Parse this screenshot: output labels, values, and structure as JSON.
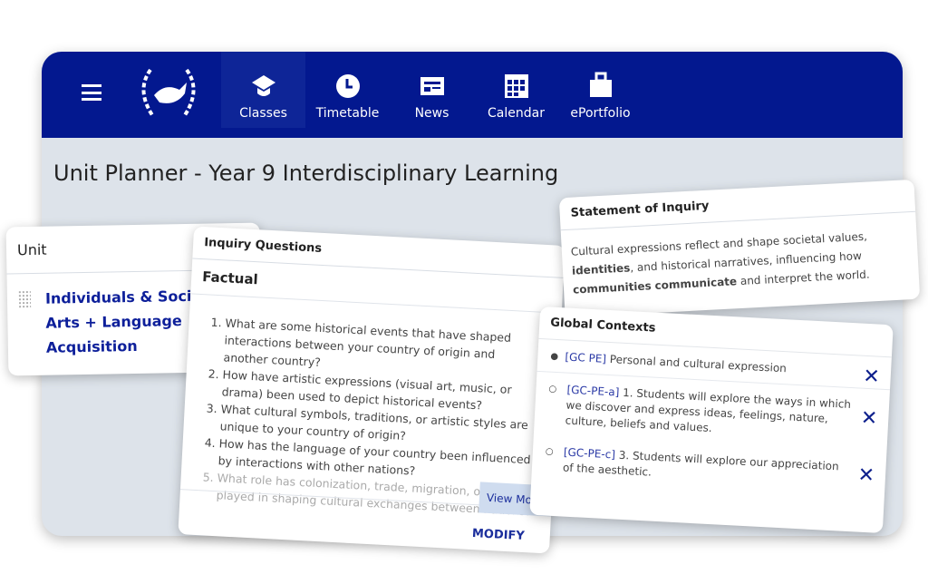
{
  "nav": {
    "items": [
      {
        "label": "Classes",
        "icon": "graduation-cap-icon",
        "active": true
      },
      {
        "label": "Timetable",
        "icon": "clock-icon"
      },
      {
        "label": "News",
        "icon": "newspaper-icon"
      },
      {
        "label": "Calendar",
        "icon": "calendar-icon"
      },
      {
        "label": "ePortfolio",
        "icon": "briefcase-icon"
      }
    ],
    "color": "#03188f"
  },
  "page": {
    "title": "Unit Planner - Year 9 Interdisciplinary Learning"
  },
  "unit": {
    "header": "Unit",
    "lines": [
      "Individuals & Societies",
      "Arts + Language",
      "Acquisition"
    ]
  },
  "inquiry": {
    "header": "Inquiry Questions",
    "section": "Factual",
    "questions": [
      "What are some historical events that have shaped interactions between your country of origin and another country?",
      "How have artistic expressions (visual art, music, or drama) been used to depict historical events?",
      "What cultural symbols, traditions, or artistic styles are unique to your country of origin?",
      "How has the language of your country been influenced by interactions with other nations?",
      "What role has colonization, trade, migration, or conflict played in shaping cultural exchanges between nations?"
    ],
    "view_more": "View More",
    "modify": "MODIFY"
  },
  "statement": {
    "header": "Statement of Inquiry",
    "parts": [
      "Cultural expressions reflect and shape societal values, ",
      "identities",
      ", and historical narratives, influencing how ",
      "communities",
      " ",
      "communicate",
      " and interpret the world."
    ]
  },
  "global": {
    "header": "Global Contexts",
    "items": [
      {
        "code": "[GC PE]",
        "text": "Personal and cultural expression"
      },
      {
        "code": "[GC-PE-a]",
        "text": "1. Students will explore the ways in which we discover and express ideas, feelings, nature, culture, beliefs and values."
      },
      {
        "code": "[GC-PE-c]",
        "text": "3. Students will explore our appreciation of the aesthetic."
      }
    ]
  }
}
